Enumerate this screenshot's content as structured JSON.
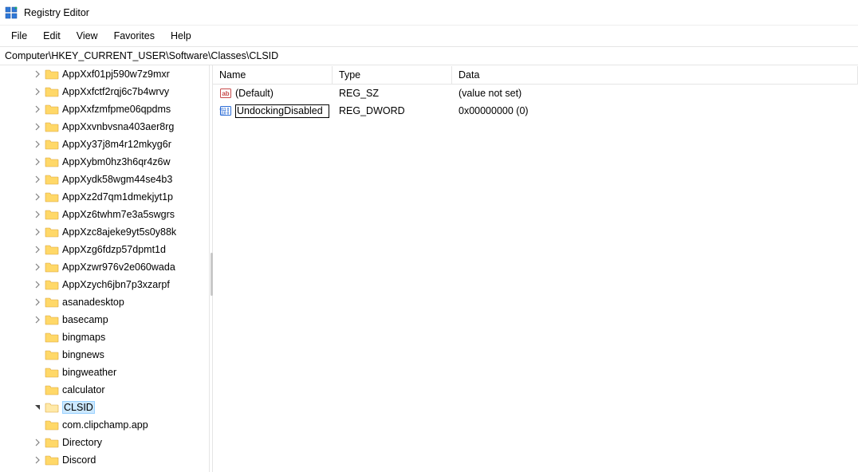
{
  "window": {
    "title": "Registry Editor"
  },
  "menu": {
    "items": [
      {
        "label": "File"
      },
      {
        "label": "Edit"
      },
      {
        "label": "View"
      },
      {
        "label": "Favorites"
      },
      {
        "label": "Help"
      }
    ]
  },
  "addressbar": {
    "path": "Computer\\HKEY_CURRENT_USER\\Software\\Classes\\CLSID"
  },
  "tree": {
    "indent_base": 42,
    "items": [
      {
        "label": "AppXxf01pj590w7z9mxr",
        "expandable": true,
        "expanded": false,
        "selected": false
      },
      {
        "label": "AppXxfctf2rqj6c7b4wrvy",
        "expandable": true,
        "expanded": false,
        "selected": false
      },
      {
        "label": "AppXxfzmfpme06qpdms",
        "expandable": true,
        "expanded": false,
        "selected": false
      },
      {
        "label": "AppXxvnbvsna403aer8rg",
        "expandable": true,
        "expanded": false,
        "selected": false
      },
      {
        "label": "AppXy37j8m4r12mkyg6r",
        "expandable": true,
        "expanded": false,
        "selected": false
      },
      {
        "label": "AppXybm0hz3h6qr4z6w",
        "expandable": true,
        "expanded": false,
        "selected": false
      },
      {
        "label": "AppXydk58wgm44se4b3",
        "expandable": true,
        "expanded": false,
        "selected": false
      },
      {
        "label": "AppXz2d7qm1dmekjyt1p",
        "expandable": true,
        "expanded": false,
        "selected": false
      },
      {
        "label": "AppXz6twhm7e3a5swgrs",
        "expandable": true,
        "expanded": false,
        "selected": false
      },
      {
        "label": "AppXzc8ajeke9yt5s0y88k",
        "expandable": true,
        "expanded": false,
        "selected": false
      },
      {
        "label": "AppXzg6fdzp57dpmt1d",
        "expandable": true,
        "expanded": false,
        "selected": false
      },
      {
        "label": "AppXzwr976v2e060wada",
        "expandable": true,
        "expanded": false,
        "selected": false
      },
      {
        "label": "AppXzych6jbn7p3xzarpf",
        "expandable": true,
        "expanded": false,
        "selected": false
      },
      {
        "label": "asanadesktop",
        "expandable": true,
        "expanded": false,
        "selected": false
      },
      {
        "label": "basecamp",
        "expandable": true,
        "expanded": false,
        "selected": false
      },
      {
        "label": "bingmaps",
        "expandable": false,
        "expanded": false,
        "selected": false
      },
      {
        "label": "bingnews",
        "expandable": false,
        "expanded": false,
        "selected": false
      },
      {
        "label": "bingweather",
        "expandable": false,
        "expanded": false,
        "selected": false
      },
      {
        "label": "calculator",
        "expandable": false,
        "expanded": false,
        "selected": false
      },
      {
        "label": "CLSID",
        "expandable": true,
        "expanded": true,
        "selected": true
      },
      {
        "label": "com.clipchamp.app",
        "expandable": false,
        "expanded": false,
        "selected": false
      },
      {
        "label": "Directory",
        "expandable": true,
        "expanded": false,
        "selected": false
      },
      {
        "label": "Discord",
        "expandable": true,
        "expanded": false,
        "selected": false
      }
    ]
  },
  "list": {
    "columns": {
      "name": "Name",
      "type": "Type",
      "data": "Data"
    },
    "rows": [
      {
        "icon": "string",
        "name": "(Default)",
        "editing": false,
        "type": "REG_SZ",
        "data": "(value not set)"
      },
      {
        "icon": "binary",
        "name": "UndockingDisabled",
        "editing": true,
        "type": "REG_DWORD",
        "data": "0x00000000 (0)"
      }
    ]
  },
  "icons": {
    "folder_fill": "#ffd868",
    "folder_stroke": "#d9a33b",
    "open_fill": "#ffe9a8"
  }
}
